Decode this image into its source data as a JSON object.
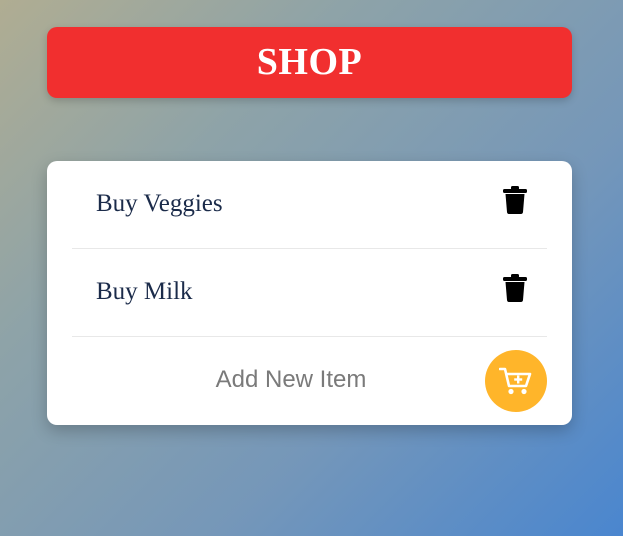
{
  "header": {
    "title": "SHOP",
    "color": "#f12f2f"
  },
  "list": {
    "items": [
      {
        "label": "Buy Veggies",
        "action_icon": "trash-icon"
      },
      {
        "label": "Buy Milk",
        "action_icon": "trash-icon"
      }
    ]
  },
  "add_item": {
    "label": "Add New Item",
    "button_icon": "cart-plus-icon",
    "button_color": "#ffb52a"
  }
}
